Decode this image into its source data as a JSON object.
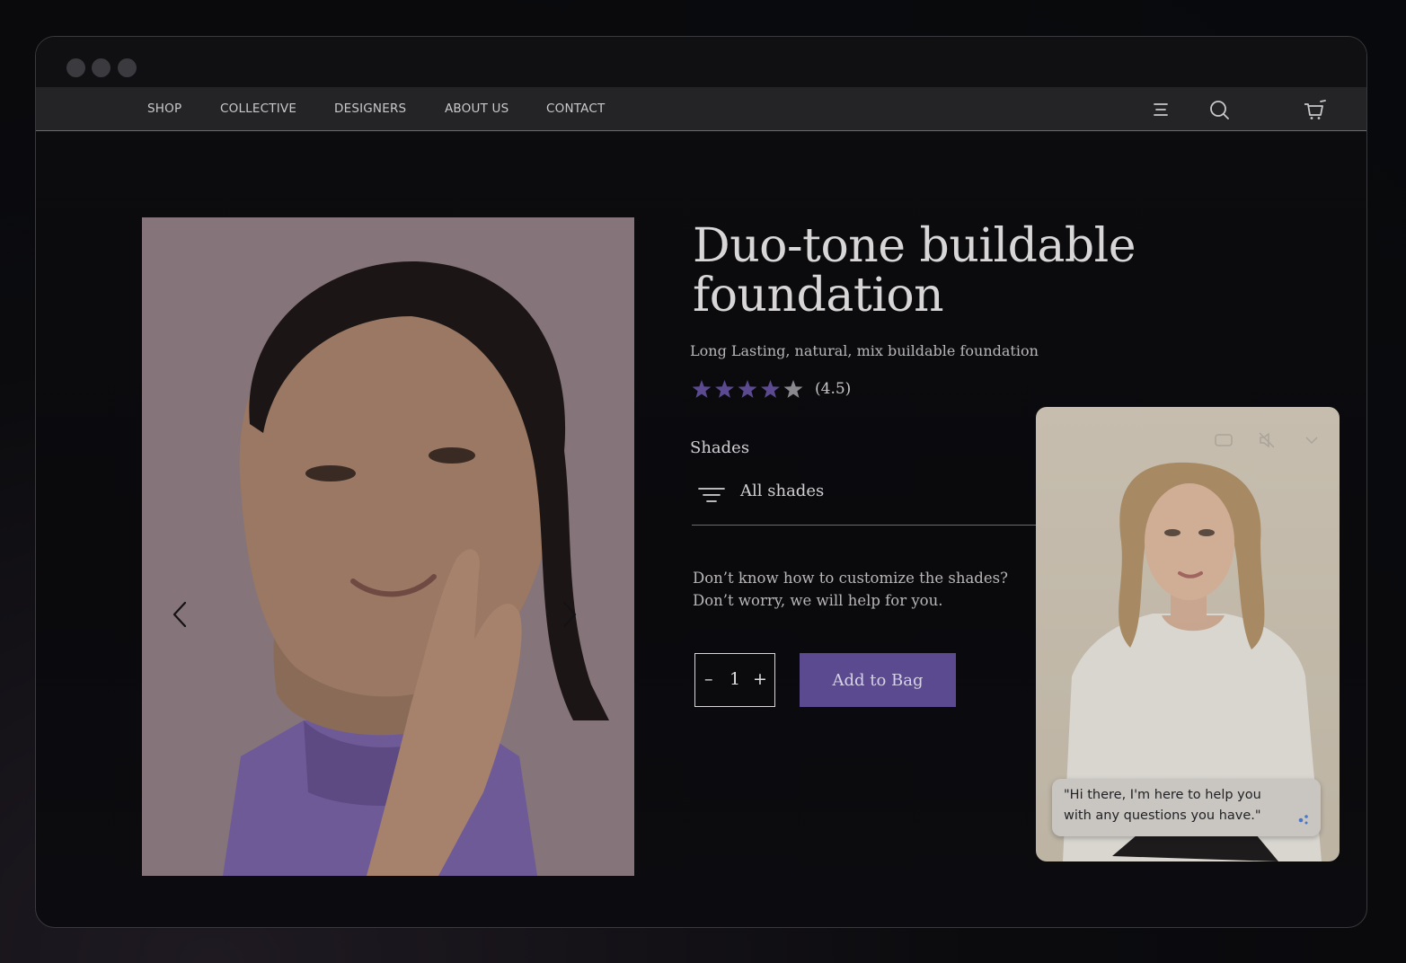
{
  "browser": {
    "window_dots": [
      "close",
      "minimize",
      "maximize"
    ]
  },
  "nav": {
    "links": [
      "SHOP",
      "COLLECTIVE",
      "DESIGNERS",
      "ABOUT US",
      "CONTACT"
    ],
    "icons": [
      "menu-icon",
      "search-icon",
      "cart-icon"
    ]
  },
  "product": {
    "title": "Duo-tone buildable foundation",
    "subtitle": "Long Lasting, natural, mix buildable foundation",
    "rating": 4.5,
    "rating_label": "(4.5)",
    "stars_total": 5,
    "shades_label": "Shades",
    "shades_value": "All shades",
    "help_line1": "Don’t know how to customize the shades?",
    "help_line2": "Don’t worry, we will help for you.",
    "quantity": {
      "minus": "–",
      "value": "1",
      "plus": "+"
    },
    "add_button": "Add to Bag"
  },
  "gallery": {
    "prev_icon": "chevron-left-icon",
    "next_icon": "chevron-right-icon"
  },
  "assistant": {
    "message": "\"Hi there, I'm here to help you with any questions you have.\"",
    "icons": [
      "captions-icon",
      "mute-icon",
      "collapse-icon"
    ]
  },
  "colors": {
    "accent": "#5b4a8f",
    "star_filled": "#5b4a8f",
    "star_empty": "#8a8a8e",
    "nav_bg": "#242426",
    "page_bg": "#0b0b0e"
  }
}
